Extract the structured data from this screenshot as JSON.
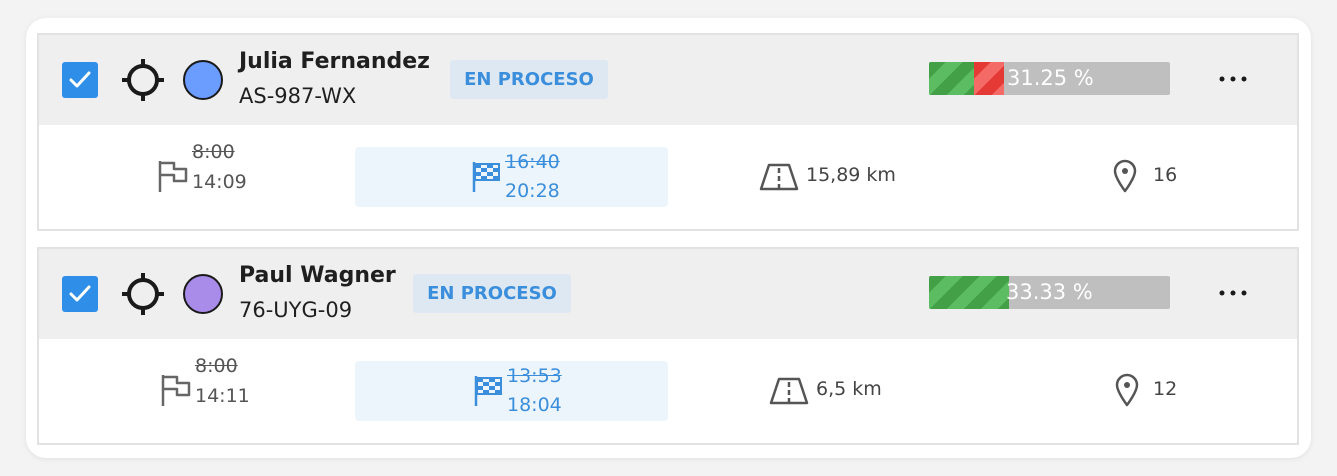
{
  "routes": [
    {
      "driver_name": "Julia Fernandez",
      "plate": "AS-987-WX",
      "status": "EN PROCESO",
      "checked": true,
      "driver_color": "#6b9cff",
      "progress_text": "31.25 %",
      "progress": {
        "completed_pct": 18.75,
        "failed_pct": 12.5
      },
      "start_planned": "8:00",
      "start_actual": "14:09",
      "end_planned": "16:40",
      "end_estimated": "20:28",
      "distance": "15,89 km",
      "stops": "16"
    },
    {
      "driver_name": "Paul Wagner",
      "plate": "76-UYG-09",
      "status": "EN PROCESO",
      "checked": true,
      "driver_color": "#a98bea",
      "progress_text": "33.33 %",
      "progress": {
        "completed_pct": 33.33,
        "failed_pct": 0
      },
      "start_planned": "8:00",
      "start_actual": "14:11",
      "end_planned": "13:53",
      "end_estimated": "18:04",
      "distance": "6,5 km",
      "stops": "12"
    }
  ],
  "icons": {
    "checkbox": "checkbox-checked-icon",
    "locate": "crosshair-icon",
    "start": "start-flag-icon",
    "finish": "checkered-flag-icon",
    "distance": "road-icon",
    "stops": "map-pin-icon",
    "menu": "more-horizontal-icon"
  },
  "colors": {
    "accent": "#2f8ee8",
    "badge_text": "#3b8edb",
    "badge_bg": "#dde8f2",
    "progress_done": "#43a047",
    "progress_failed": "#e53935",
    "progress_rest": "#bfbfbf"
  }
}
